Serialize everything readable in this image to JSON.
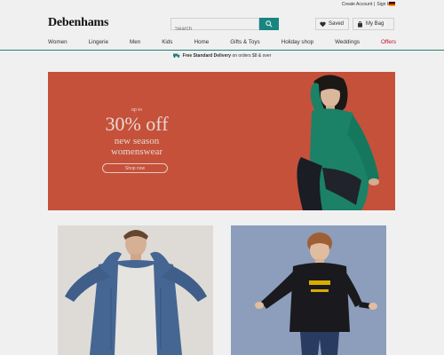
{
  "header": {
    "top_links": [
      "Create Account",
      "Sign In"
    ],
    "brand": "Debenhams",
    "search_placeholder": "Search",
    "saved_label": "Saved",
    "bag_label": "My Bag",
    "colors": {
      "accent": "#1a8e8a",
      "offers": "#c8102e"
    }
  },
  "nav": {
    "items": [
      "Women",
      "Lingerie",
      "Men",
      "Kids",
      "Home",
      "Gifts & Toys",
      "Holiday shop",
      "Weddings",
      "Offers"
    ]
  },
  "delivery": {
    "bold": "Free Standard Delivery",
    "rest": " on orders $8 & over"
  },
  "hero": {
    "upto": "up to",
    "percent": "30% off",
    "line2": "new season",
    "line3": "womenswear",
    "cta": "Shop now",
    "background": "#d2573f"
  },
  "tiles": [
    {
      "background": "#ece9e4"
    },
    {
      "background": "#95a8c8"
    }
  ]
}
